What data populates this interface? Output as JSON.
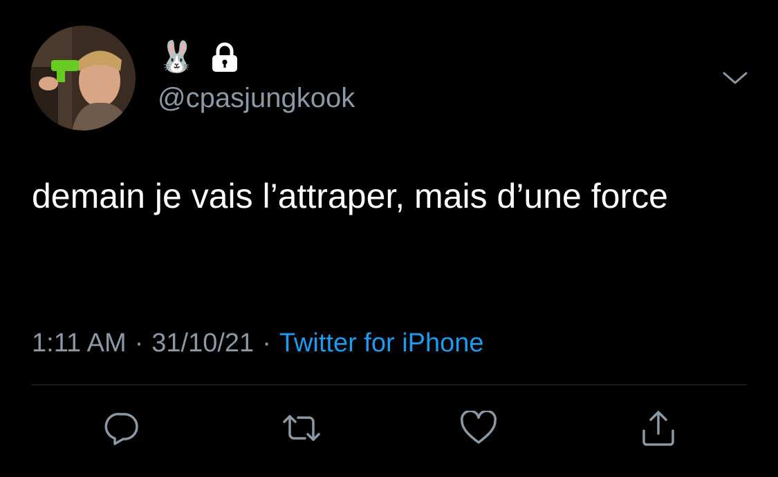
{
  "header": {
    "emoji": "🐰",
    "handle": "@cpasjungkook"
  },
  "tweet": {
    "text": "demain je vais l’attraper, mais d’une force"
  },
  "meta": {
    "time": "1:11 AM",
    "separator": "·",
    "date": "31/10/21",
    "source": "Twitter for iPhone"
  },
  "icons": {
    "lock": "lock-icon",
    "menu": "chevron-down-icon",
    "reply": "reply-icon",
    "retweet": "retweet-icon",
    "like": "heart-icon",
    "share": "share-icon"
  },
  "colors": {
    "background": "#000000",
    "text": "#ffffff",
    "muted": "#8b98a5",
    "link": "#1d9bf0",
    "divider": "#2f3336"
  }
}
